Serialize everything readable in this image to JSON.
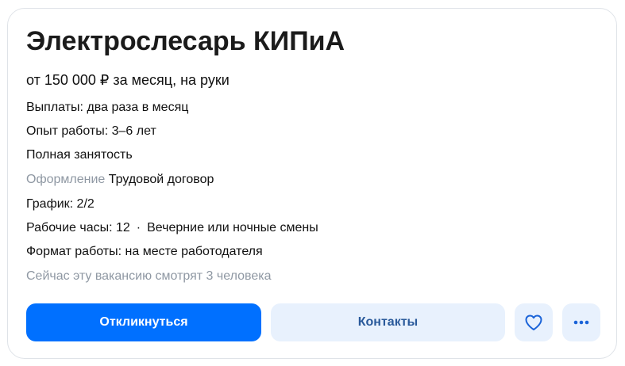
{
  "vacancy": {
    "title": "Электрослесарь КИПиА",
    "salary": "от 150 000 ₽ за месяц, на руки",
    "payments": "Выплаты: два раза в месяц",
    "experience": "Опыт работы: 3–6 лет",
    "employment": "Полная занятость",
    "registration_label": "Оформление",
    "registration_value": "Трудовой договор",
    "schedule": "График: 2/2",
    "work_hours": "Рабочие часы: 12",
    "separator": "·",
    "shifts": "Вечерние или ночные смены",
    "work_format": "Формат работы: на месте работодателя",
    "viewers": "Сейчас эту вакансию смотрят 3 человека"
  },
  "actions": {
    "respond_label": "Откликнуться",
    "contacts_label": "Контакты",
    "favorite_icon": "heart-icon",
    "more_icon": "more-dots-icon"
  },
  "colors": {
    "primary": "#0070ff",
    "secondary_bg": "#e8f1fd",
    "secondary_text": "#2a5a9b",
    "muted_text": "#8f98a3",
    "border": "#dfe3e8"
  }
}
